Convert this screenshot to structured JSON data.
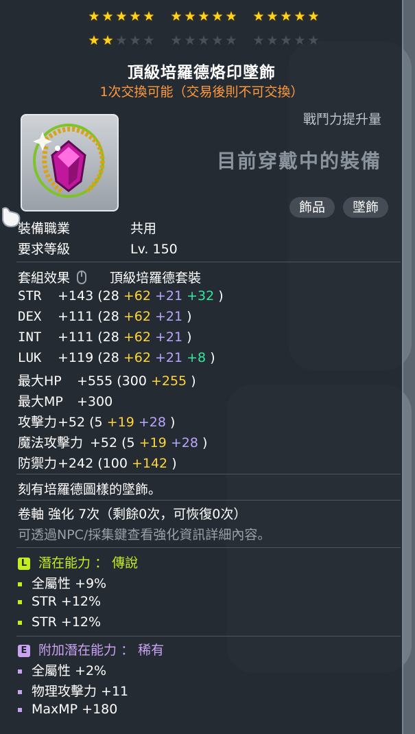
{
  "stars": {
    "row1": [
      [
        1,
        1,
        1,
        1,
        1
      ],
      [
        1,
        1,
        1,
        1,
        1
      ],
      [
        1,
        1,
        1,
        1,
        1
      ]
    ],
    "row2": [
      [
        1,
        1,
        0,
        0,
        0
      ],
      [
        0,
        0,
        0,
        0,
        0
      ],
      [
        0,
        0,
        0,
        0,
        0
      ]
    ]
  },
  "item": {
    "name": "頂級培羅德烙印墜飾",
    "trade_note": "1次交換可能（交易後則不可交換）",
    "icon": "pendant-icon"
  },
  "right_panel": {
    "cp_label": "戰鬥力提升量",
    "equipped_label": "目前穿戴中的裝備",
    "tags": [
      "飾品",
      "墜飾"
    ]
  },
  "requirements": {
    "job_label": "裝備職業",
    "job_value": "共用",
    "level_label": "要求等級",
    "level_value": "Lv. 150"
  },
  "set": {
    "label": "套組效果",
    "icon": "mouse-icon",
    "value": "頂級培羅德套裝"
  },
  "stats": [
    {
      "name": "STR",
      "total": "+143",
      "base": "28",
      "yellow": "+62",
      "purple": "+21",
      "green": "+32"
    },
    {
      "name": "DEX",
      "total": "+111",
      "base": "28",
      "yellow": "+62",
      "purple": "+21",
      "green": ""
    },
    {
      "name": "INT",
      "total": "+111",
      "base": "28",
      "yellow": "+62",
      "purple": "+21",
      "green": ""
    },
    {
      "name": "LUK",
      "total": "+119",
      "base": "28",
      "yellow": "+62",
      "purple": "+21",
      "green": "+8"
    },
    {
      "name": "最大HP",
      "total": "+555",
      "base": "300",
      "yellow": "+255",
      "purple": "",
      "green": ""
    },
    {
      "name": "最大MP",
      "total": "+300",
      "base": "",
      "yellow": "",
      "purple": "",
      "green": ""
    },
    {
      "name": "攻擊力",
      "total": "+52",
      "base": "5",
      "yellow": "+19",
      "purple": "+28",
      "green": ""
    },
    {
      "name": "魔法攻擊力",
      "total": "+52",
      "base": "5",
      "yellow": "+19",
      "purple": "+28",
      "green": ""
    },
    {
      "name": "防禦力",
      "total": "+242",
      "base": "100",
      "yellow": "+142",
      "purple": "",
      "green": ""
    }
  ],
  "description": "刻有培羅德圖樣的墜飾。",
  "scroll": {
    "text": "卷軸 強化 7次（剩餘0次，可恢復0次）",
    "hint": "可透過NPC/採集鍵查看強化資訊詳細內容。"
  },
  "potential": {
    "badge": "L",
    "title": "潛在能力 ： 傳說",
    "color": "#c3ee24",
    "lines": [
      "全屬性 +9%",
      "STR +12%",
      "STR +12%"
    ]
  },
  "bonus_potential": {
    "badge": "E",
    "title": "附加潛在能力 ： 稀有",
    "color": "#c9a3f2",
    "lines": [
      "全屬性 +2%",
      "物理攻擊力 +11",
      "MaxMP +180"
    ]
  },
  "colors": {
    "yellow": "#ffd53a",
    "purple": "#b9a6ff",
    "green": "#33e7a0",
    "orange": "#ff9a3c"
  }
}
